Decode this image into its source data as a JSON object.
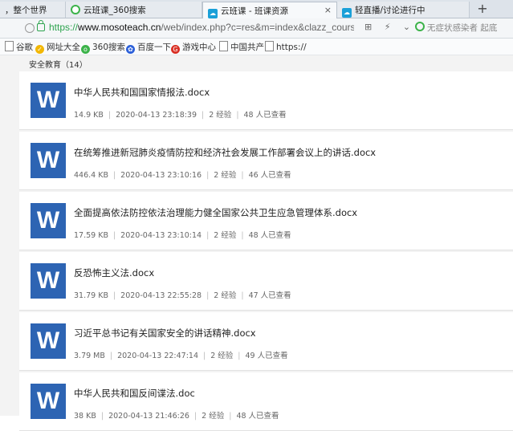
{
  "tabs": [
    {
      "label": "，整个世界",
      "icon": "",
      "active": false
    },
    {
      "label": "云班课_360搜索",
      "icon": "so-icon",
      "active": false
    },
    {
      "label": "云班课 - 班课资源",
      "icon": "mosoteach-icon",
      "active": true
    },
    {
      "label": "轻直播/讨论进行中",
      "icon": "mosoteach-icon",
      "active": false
    }
  ],
  "tab_close": "×",
  "new_tab": "+",
  "address": {
    "scheme": "https://",
    "host": "www.mosoteach.cn",
    "path": "/web/index.php?c=res&m=index&clazz_course_id="
  },
  "address_icons": "⊞ ⚡ ⌄",
  "status_text": "无症状感染者 起底",
  "bookmarks": [
    {
      "label": "谷歌",
      "icon": "doc-icon"
    },
    {
      "label": "网址大全",
      "icon": "hao360-icon",
      "color": "#f2b705"
    },
    {
      "label": "360搜索",
      "icon": "so-icon",
      "color": "#3cb34a"
    },
    {
      "label": "百度一下",
      "icon": "baidu-icon",
      "color": "#2b5fd9"
    },
    {
      "label": "游戏中心",
      "icon": "game-icon",
      "color": "#d93025"
    },
    {
      "label": "中国共产",
      "icon": "doc-icon"
    },
    {
      "label": "https://",
      "icon": "doc-icon"
    }
  ],
  "section_title": "安全教育（14）",
  "file_icon_letter": "W",
  "files": [
    {
      "name": "中华人民共和国国家情报法.docx",
      "size": "14.9 KB",
      "date": "2020-04-13 23:18:39",
      "exp": "2 经验",
      "views": "48 人已查看"
    },
    {
      "name": "在统筹推进新冠肺炎疫情防控和经济社会发展工作部署会议上的讲话.docx",
      "size": "446.4 KB",
      "date": "2020-04-13 23:10:16",
      "exp": "2 经验",
      "views": "46 人已查看"
    },
    {
      "name": "全面提高依法防控依法治理能力健全国家公共卫生应急管理体系.docx",
      "size": "17.59 KB",
      "date": "2020-04-13 23:10:14",
      "exp": "2 经验",
      "views": "48 人已查看"
    },
    {
      "name": "反恐怖主义法.docx",
      "size": "31.79 KB",
      "date": "2020-04-13 22:55:28",
      "exp": "2 经验",
      "views": "47 人已查看"
    },
    {
      "name": "习近平总书记有关国家安全的讲话精神.docx",
      "size": "3.79 MB",
      "date": "2020-04-13 22:47:14",
      "exp": "2 经验",
      "views": "49 人已查看"
    },
    {
      "name": "中华人民共和国反间谍法.doc",
      "size": "38 KB",
      "date": "2020-04-13 21:46:26",
      "exp": "2 经验",
      "views": "48 人已查看"
    }
  ]
}
